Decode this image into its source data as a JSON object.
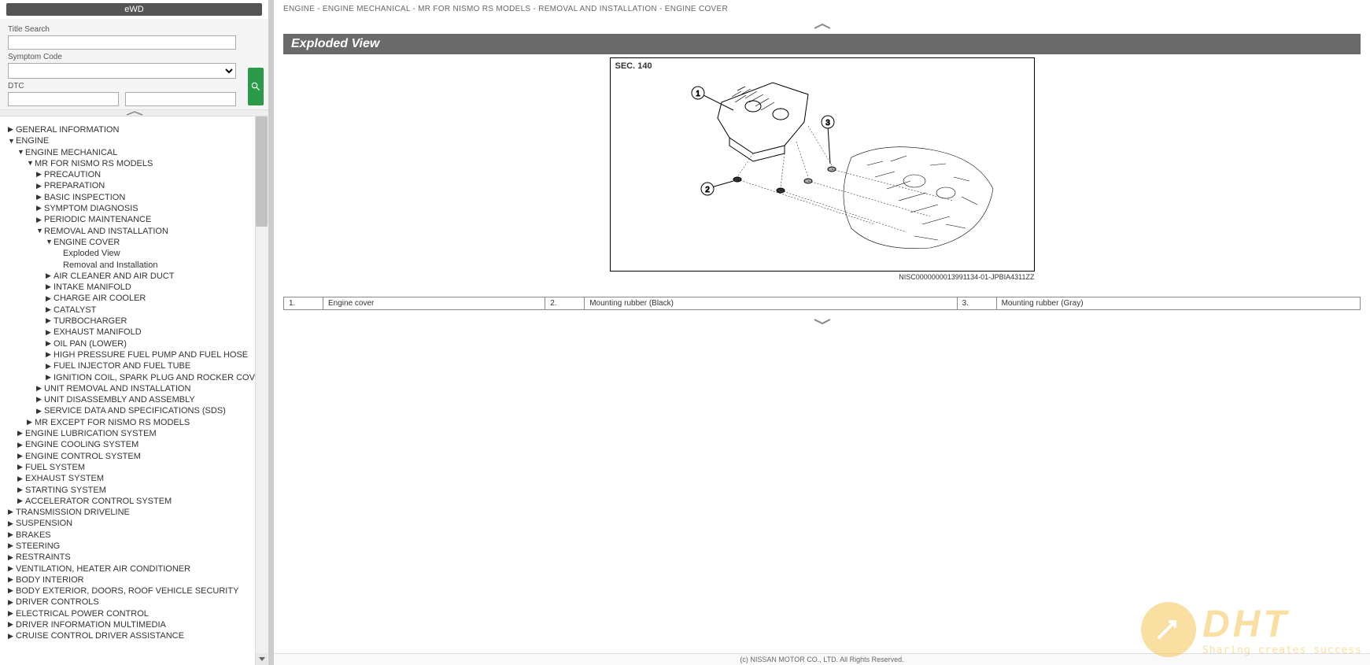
{
  "header": {
    "ewd": "eWD"
  },
  "search": {
    "title_label": "Title Search",
    "symptom_label": "Symptom Code",
    "dtc_label": "DTC"
  },
  "tree": [
    {
      "l": "GENERAL INFORMATION",
      "e": false
    },
    {
      "l": "ENGINE",
      "e": true,
      "c": [
        {
          "l": "ENGINE MECHANICAL",
          "e": true,
          "c": [
            {
              "l": "MR FOR NISMO RS MODELS",
              "e": true,
              "c": [
                {
                  "l": "PRECAUTION",
                  "e": false
                },
                {
                  "l": "PREPARATION",
                  "e": false
                },
                {
                  "l": "BASIC INSPECTION",
                  "e": false
                },
                {
                  "l": "SYMPTOM DIAGNOSIS",
                  "e": false
                },
                {
                  "l": "PERIODIC MAINTENANCE",
                  "e": false
                },
                {
                  "l": "REMOVAL AND INSTALLATION",
                  "e": true,
                  "c": [
                    {
                      "l": "ENGINE COVER",
                      "e": true,
                      "c": [
                        {
                          "l": "Exploded View",
                          "leaf": true
                        },
                        {
                          "l": "Removal and Installation",
                          "leaf": true
                        }
                      ]
                    },
                    {
                      "l": "AIR CLEANER AND AIR DUCT",
                      "e": false
                    },
                    {
                      "l": "INTAKE MANIFOLD",
                      "e": false
                    },
                    {
                      "l": "CHARGE AIR COOLER",
                      "e": false
                    },
                    {
                      "l": "CATALYST",
                      "e": false
                    },
                    {
                      "l": "TURBOCHARGER",
                      "e": false
                    },
                    {
                      "l": "EXHAUST MANIFOLD",
                      "e": false
                    },
                    {
                      "l": "OIL PAN (LOWER)",
                      "e": false
                    },
                    {
                      "l": "HIGH PRESSURE FUEL PUMP AND FUEL HOSE",
                      "e": false
                    },
                    {
                      "l": "FUEL INJECTOR AND FUEL TUBE",
                      "e": false
                    },
                    {
                      "l": "IGNITION COIL, SPARK PLUG AND ROCKER COVER",
                      "e": false
                    }
                  ]
                },
                {
                  "l": "UNIT REMOVAL AND INSTALLATION",
                  "e": false
                },
                {
                  "l": "UNIT DISASSEMBLY AND ASSEMBLY",
                  "e": false
                },
                {
                  "l": "SERVICE DATA AND SPECIFICATIONS (SDS)",
                  "e": false
                }
              ]
            },
            {
              "l": "MR EXCEPT FOR NISMO RS MODELS",
              "e": false
            }
          ]
        },
        {
          "l": "ENGINE LUBRICATION SYSTEM",
          "e": false
        },
        {
          "l": "ENGINE COOLING SYSTEM",
          "e": false
        },
        {
          "l": "ENGINE CONTROL SYSTEM",
          "e": false
        },
        {
          "l": "FUEL SYSTEM",
          "e": false
        },
        {
          "l": "EXHAUST SYSTEM",
          "e": false
        },
        {
          "l": "STARTING SYSTEM",
          "e": false
        },
        {
          "l": "ACCELERATOR CONTROL SYSTEM",
          "e": false
        }
      ]
    },
    {
      "l": "TRANSMISSION DRIVELINE",
      "e": false
    },
    {
      "l": "SUSPENSION",
      "e": false
    },
    {
      "l": "BRAKES",
      "e": false
    },
    {
      "l": "STEERING",
      "e": false
    },
    {
      "l": "RESTRAINTS",
      "e": false
    },
    {
      "l": "VENTILATION, HEATER AIR CONDITIONER",
      "e": false
    },
    {
      "l": "BODY INTERIOR",
      "e": false
    },
    {
      "l": "BODY EXTERIOR, DOORS, ROOF VEHICLE SECURITY",
      "e": false
    },
    {
      "l": "DRIVER CONTROLS",
      "e": false
    },
    {
      "l": "ELECTRICAL POWER CONTROL",
      "e": false
    },
    {
      "l": "DRIVER INFORMATION MULTIMEDIA",
      "e": false
    },
    {
      "l": "CRUISE CONTROL DRIVER ASSISTANCE",
      "e": false
    }
  ],
  "breadcrumb": "ENGINE - ENGINE MECHANICAL - MR FOR NISMO RS MODELS - REMOVAL AND INSTALLATION - ENGINE COVER",
  "exploded_title": "Exploded View",
  "diagram": {
    "section": "SEC. 140",
    "id": "NISC0000000013991134-01-JPBIA4311ZZ"
  },
  "parts": [
    {
      "n": "1.",
      "name": "Engine cover"
    },
    {
      "n": "2.",
      "name": "Mounting rubber (Black)"
    },
    {
      "n": "3.",
      "name": "Mounting rubber (Gray)"
    }
  ],
  "footer": "(c) NISSAN MOTOR CO., LTD. All Rights Reserved.",
  "watermark": {
    "text": "DHT",
    "tagline": "Sharing creates success"
  }
}
